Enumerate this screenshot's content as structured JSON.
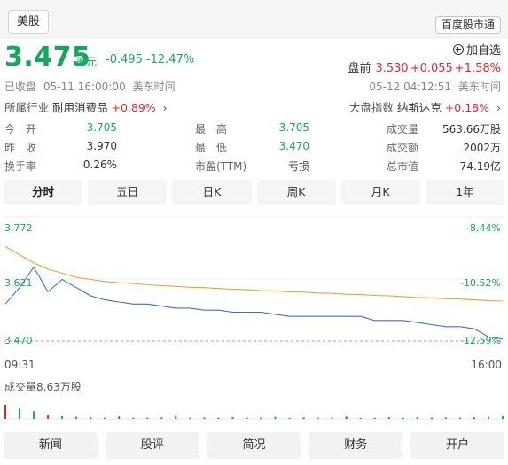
{
  "header": {
    "market_tab": "美股",
    "connect_button": "百度股市通"
  },
  "quote": {
    "price": "3.475",
    "currency": "美元",
    "change": "-0.495",
    "change_pct": "-12.47%",
    "watch_label": "加自选",
    "premarket": {
      "label": "盘前",
      "price": "3.530",
      "change": "+0.055",
      "change_pct": "+1.58%"
    },
    "status": {
      "left_state": "已收盘",
      "left_time": "05-11 16:00:00",
      "left_tz": "美东时间",
      "right_time": "05-12 04:12:51",
      "right_tz": "美东时间"
    },
    "industry": {
      "label": "所属行业",
      "name": "耐用消费品",
      "change": "+0.89%"
    },
    "index": {
      "label": "大盘指数",
      "name": "纳斯达克",
      "change": "+0.18%"
    }
  },
  "stats": [
    {
      "key": "今　开",
      "value": "3.705",
      "color": "#14a85d"
    },
    {
      "key": "最　高",
      "value": "3.705",
      "color": "#14a85d"
    },
    {
      "key": "成交量",
      "value": "563.66万股",
      "color": "#333333"
    },
    {
      "key": "昨　收",
      "value": "3.970",
      "color": "#333333"
    },
    {
      "key": "最　低",
      "value": "3.470",
      "color": "#14a85d"
    },
    {
      "key": "成交额",
      "value": "2002万",
      "color": "#333333"
    },
    {
      "key": "换手率",
      "value": "0.26%",
      "color": "#333333"
    },
    {
      "key": "市盈(TTM)",
      "value": "亏损",
      "color": "#333333"
    },
    {
      "key": "总市值",
      "value": "74.19亿",
      "color": "#333333"
    }
  ],
  "tabs": [
    {
      "label": "分时",
      "active": true
    },
    {
      "label": "五日",
      "active": false
    },
    {
      "label": "日K",
      "active": false
    },
    {
      "label": "周K",
      "active": false
    },
    {
      "label": "月K",
      "active": false
    },
    {
      "label": "1年",
      "active": false
    }
  ],
  "chart_data": {
    "type": "line",
    "y_left_labels": [
      "3.772",
      "3.621",
      "3.470"
    ],
    "y_right_labels": [
      "-8.44%",
      "-10.52%",
      "-12.59%"
    ],
    "ylim": [
      3.47,
      3.772
    ],
    "x_labels": [
      "09:31",
      "16:00"
    ],
    "baseline": 3.47,
    "series": [
      {
        "role": "price",
        "color": "#3b6fd4",
        "values": [
          3.56,
          3.6,
          3.65,
          3.59,
          3.62,
          3.6,
          3.58,
          3.57,
          3.565,
          3.56,
          3.56,
          3.555,
          3.55,
          3.55,
          3.545,
          3.545,
          3.54,
          3.54,
          3.54,
          3.535,
          3.53,
          3.53,
          3.53,
          3.53,
          3.53,
          3.53,
          3.52,
          3.52,
          3.52,
          3.515,
          3.51,
          3.505,
          3.505,
          3.5,
          3.48,
          3.475
        ]
      },
      {
        "role": "average",
        "color": "#f0a030",
        "values": [
          3.7,
          3.68,
          3.66,
          3.645,
          3.635,
          3.625,
          3.62,
          3.615,
          3.612,
          3.61,
          3.607,
          3.605,
          3.603,
          3.601,
          3.6,
          3.598,
          3.596,
          3.595,
          3.593,
          3.592,
          3.59,
          3.589,
          3.587,
          3.586,
          3.584,
          3.583,
          3.581,
          3.58,
          3.578,
          3.576,
          3.575,
          3.573,
          3.572,
          3.57,
          3.568,
          3.567
        ]
      }
    ],
    "volume": {
      "title": "成交量8.63万股",
      "bars": [
        0.55,
        0.4,
        0.3,
        0.15,
        0.1,
        0.08,
        0.06,
        0.05,
        0.1,
        0.04,
        0.05,
        0.06,
        0.12,
        0.05,
        0.06,
        0.04,
        0.07,
        0.05,
        0.05,
        0.08,
        0.04,
        0.06,
        0.05,
        0.05,
        0.09,
        0.04,
        0.05,
        0.06,
        0.04,
        0.07,
        0.05,
        0.06,
        0.05,
        0.06,
        0.08,
        0.1
      ]
    }
  },
  "bottom_nav": [
    "新闻",
    "股评",
    "简况",
    "财务",
    "开户"
  ]
}
